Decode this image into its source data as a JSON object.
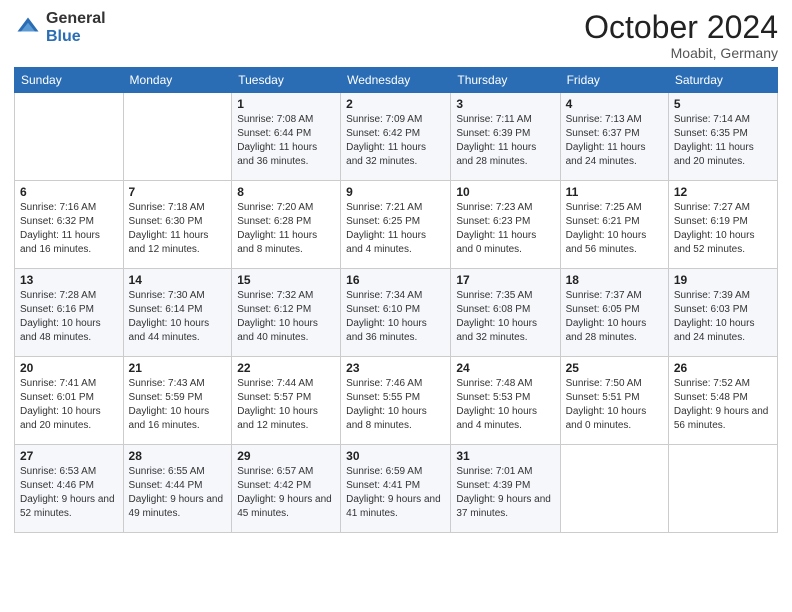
{
  "logo": {
    "general": "General",
    "blue": "Blue"
  },
  "header": {
    "month": "October 2024",
    "location": "Moabit, Germany"
  },
  "weekdays": [
    "Sunday",
    "Monday",
    "Tuesday",
    "Wednesday",
    "Thursday",
    "Friday",
    "Saturday"
  ],
  "weeks": [
    [
      {
        "day": "",
        "sunrise": "",
        "sunset": "",
        "daylight": ""
      },
      {
        "day": "",
        "sunrise": "",
        "sunset": "",
        "daylight": ""
      },
      {
        "day": "1",
        "sunrise": "Sunrise: 7:08 AM",
        "sunset": "Sunset: 6:44 PM",
        "daylight": "Daylight: 11 hours and 36 minutes."
      },
      {
        "day": "2",
        "sunrise": "Sunrise: 7:09 AM",
        "sunset": "Sunset: 6:42 PM",
        "daylight": "Daylight: 11 hours and 32 minutes."
      },
      {
        "day": "3",
        "sunrise": "Sunrise: 7:11 AM",
        "sunset": "Sunset: 6:39 PM",
        "daylight": "Daylight: 11 hours and 28 minutes."
      },
      {
        "day": "4",
        "sunrise": "Sunrise: 7:13 AM",
        "sunset": "Sunset: 6:37 PM",
        "daylight": "Daylight: 11 hours and 24 minutes."
      },
      {
        "day": "5",
        "sunrise": "Sunrise: 7:14 AM",
        "sunset": "Sunset: 6:35 PM",
        "daylight": "Daylight: 11 hours and 20 minutes."
      }
    ],
    [
      {
        "day": "6",
        "sunrise": "Sunrise: 7:16 AM",
        "sunset": "Sunset: 6:32 PM",
        "daylight": "Daylight: 11 hours and 16 minutes."
      },
      {
        "day": "7",
        "sunrise": "Sunrise: 7:18 AM",
        "sunset": "Sunset: 6:30 PM",
        "daylight": "Daylight: 11 hours and 12 minutes."
      },
      {
        "day": "8",
        "sunrise": "Sunrise: 7:20 AM",
        "sunset": "Sunset: 6:28 PM",
        "daylight": "Daylight: 11 hours and 8 minutes."
      },
      {
        "day": "9",
        "sunrise": "Sunrise: 7:21 AM",
        "sunset": "Sunset: 6:25 PM",
        "daylight": "Daylight: 11 hours and 4 minutes."
      },
      {
        "day": "10",
        "sunrise": "Sunrise: 7:23 AM",
        "sunset": "Sunset: 6:23 PM",
        "daylight": "Daylight: 11 hours and 0 minutes."
      },
      {
        "day": "11",
        "sunrise": "Sunrise: 7:25 AM",
        "sunset": "Sunset: 6:21 PM",
        "daylight": "Daylight: 10 hours and 56 minutes."
      },
      {
        "day": "12",
        "sunrise": "Sunrise: 7:27 AM",
        "sunset": "Sunset: 6:19 PM",
        "daylight": "Daylight: 10 hours and 52 minutes."
      }
    ],
    [
      {
        "day": "13",
        "sunrise": "Sunrise: 7:28 AM",
        "sunset": "Sunset: 6:16 PM",
        "daylight": "Daylight: 10 hours and 48 minutes."
      },
      {
        "day": "14",
        "sunrise": "Sunrise: 7:30 AM",
        "sunset": "Sunset: 6:14 PM",
        "daylight": "Daylight: 10 hours and 44 minutes."
      },
      {
        "day": "15",
        "sunrise": "Sunrise: 7:32 AM",
        "sunset": "Sunset: 6:12 PM",
        "daylight": "Daylight: 10 hours and 40 minutes."
      },
      {
        "day": "16",
        "sunrise": "Sunrise: 7:34 AM",
        "sunset": "Sunset: 6:10 PM",
        "daylight": "Daylight: 10 hours and 36 minutes."
      },
      {
        "day": "17",
        "sunrise": "Sunrise: 7:35 AM",
        "sunset": "Sunset: 6:08 PM",
        "daylight": "Daylight: 10 hours and 32 minutes."
      },
      {
        "day": "18",
        "sunrise": "Sunrise: 7:37 AM",
        "sunset": "Sunset: 6:05 PM",
        "daylight": "Daylight: 10 hours and 28 minutes."
      },
      {
        "day": "19",
        "sunrise": "Sunrise: 7:39 AM",
        "sunset": "Sunset: 6:03 PM",
        "daylight": "Daylight: 10 hours and 24 minutes."
      }
    ],
    [
      {
        "day": "20",
        "sunrise": "Sunrise: 7:41 AM",
        "sunset": "Sunset: 6:01 PM",
        "daylight": "Daylight: 10 hours and 20 minutes."
      },
      {
        "day": "21",
        "sunrise": "Sunrise: 7:43 AM",
        "sunset": "Sunset: 5:59 PM",
        "daylight": "Daylight: 10 hours and 16 minutes."
      },
      {
        "day": "22",
        "sunrise": "Sunrise: 7:44 AM",
        "sunset": "Sunset: 5:57 PM",
        "daylight": "Daylight: 10 hours and 12 minutes."
      },
      {
        "day": "23",
        "sunrise": "Sunrise: 7:46 AM",
        "sunset": "Sunset: 5:55 PM",
        "daylight": "Daylight: 10 hours and 8 minutes."
      },
      {
        "day": "24",
        "sunrise": "Sunrise: 7:48 AM",
        "sunset": "Sunset: 5:53 PM",
        "daylight": "Daylight: 10 hours and 4 minutes."
      },
      {
        "day": "25",
        "sunrise": "Sunrise: 7:50 AM",
        "sunset": "Sunset: 5:51 PM",
        "daylight": "Daylight: 10 hours and 0 minutes."
      },
      {
        "day": "26",
        "sunrise": "Sunrise: 7:52 AM",
        "sunset": "Sunset: 5:48 PM",
        "daylight": "Daylight: 9 hours and 56 minutes."
      }
    ],
    [
      {
        "day": "27",
        "sunrise": "Sunrise: 6:53 AM",
        "sunset": "Sunset: 4:46 PM",
        "daylight": "Daylight: 9 hours and 52 minutes."
      },
      {
        "day": "28",
        "sunrise": "Sunrise: 6:55 AM",
        "sunset": "Sunset: 4:44 PM",
        "daylight": "Daylight: 9 hours and 49 minutes."
      },
      {
        "day": "29",
        "sunrise": "Sunrise: 6:57 AM",
        "sunset": "Sunset: 4:42 PM",
        "daylight": "Daylight: 9 hours and 45 minutes."
      },
      {
        "day": "30",
        "sunrise": "Sunrise: 6:59 AM",
        "sunset": "Sunset: 4:41 PM",
        "daylight": "Daylight: 9 hours and 41 minutes."
      },
      {
        "day": "31",
        "sunrise": "Sunrise: 7:01 AM",
        "sunset": "Sunset: 4:39 PM",
        "daylight": "Daylight: 9 hours and 37 minutes."
      },
      {
        "day": "",
        "sunrise": "",
        "sunset": "",
        "daylight": ""
      },
      {
        "day": "",
        "sunrise": "",
        "sunset": "",
        "daylight": ""
      }
    ]
  ]
}
